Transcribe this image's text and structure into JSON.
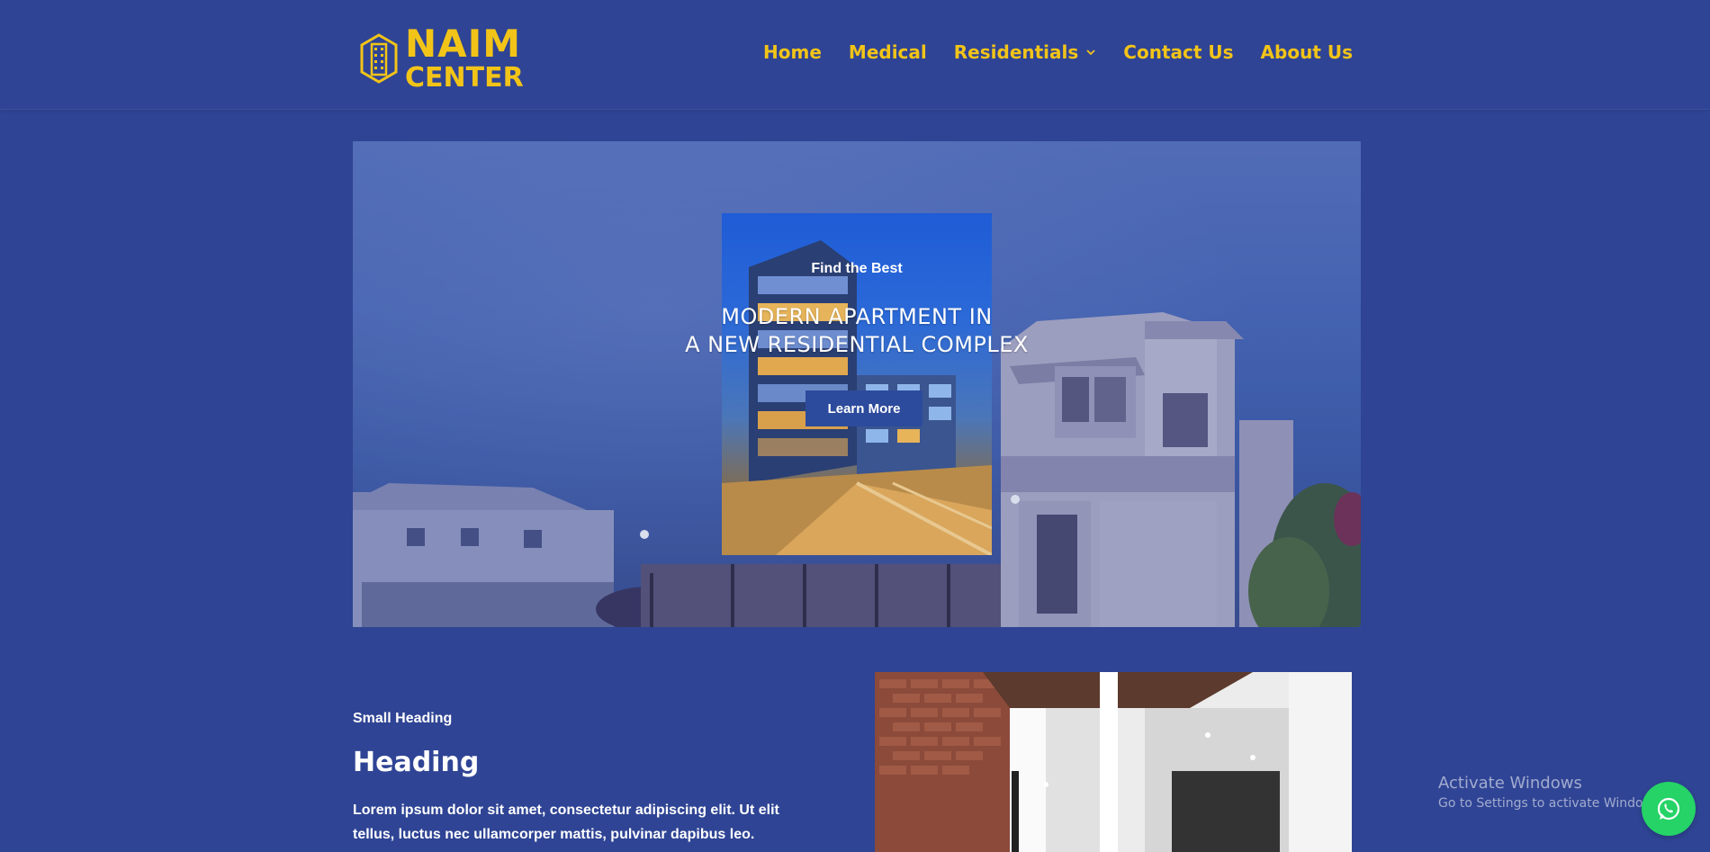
{
  "brand": {
    "line1": "NAIM",
    "line2": "CENTER",
    "accent": "#f2c418",
    "background": "#2f4494"
  },
  "nav": {
    "items": [
      {
        "label": "Home"
      },
      {
        "label": "Medical"
      },
      {
        "label": "Residentials",
        "has_dropdown": true
      },
      {
        "label": "Contact Us"
      },
      {
        "label": "About Us"
      }
    ]
  },
  "hero": {
    "eyebrow": "Find the Best",
    "title_line1": "MODERN APARTMENT IN",
    "title_line2": "A NEW RESIDENTIAL COMPLEX",
    "button_label": "Learn More"
  },
  "section": {
    "small_heading": "Small Heading",
    "heading": "Heading",
    "body": "Lorem ipsum dolor sit amet, consectetur adipiscing elit. Ut elit tellus, luctus nec ullamcorper mattis, pulvinar dapibus leo."
  },
  "watermark": {
    "line1": "Activate Windows",
    "line2": "Go to Settings to activate Windows."
  },
  "icons": {
    "logo": "building-hexagon-icon",
    "dropdown": "chevron-down-icon",
    "chat": "whatsapp-icon"
  }
}
